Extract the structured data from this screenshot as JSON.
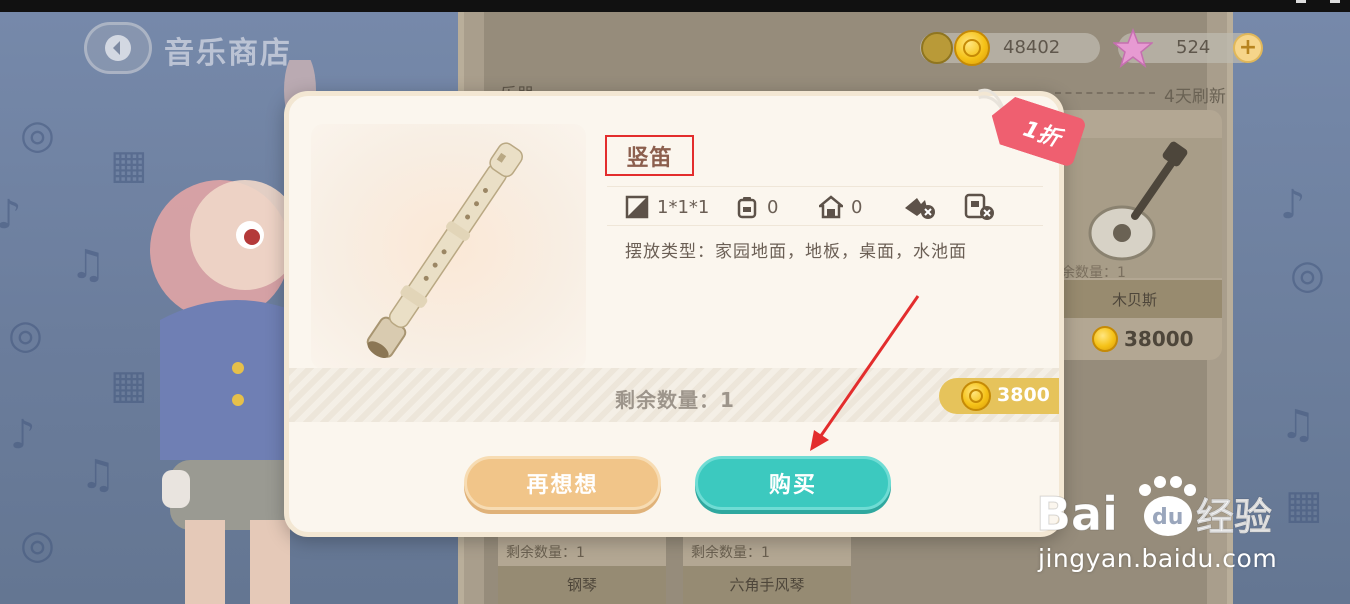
{
  "window": {
    "title": ""
  },
  "header": {
    "title": "音乐商店",
    "back_icon": "chevron-left-icon"
  },
  "currency": {
    "coins": "48402",
    "stars": "524",
    "plus_label": "+"
  },
  "shop": {
    "category_label": "乐器",
    "refresh_label": "4天刷新",
    "items": [
      {
        "name": "木贝斯",
        "price": "38000",
        "remain": "剩余数量：1"
      },
      {
        "name": "钢琴",
        "remain": "剩余数量：1"
      },
      {
        "name": "六角手风琴",
        "remain": "剩余数量：1"
      }
    ]
  },
  "modal": {
    "item_name": "竖笛",
    "discount": "1折",
    "stats": {
      "size": "1*1*1",
      "storage": "0",
      "house": "0"
    },
    "placement": "摆放类型：家园地面，地板，桌面，水池面",
    "remain": "剩余数量：1",
    "price": "3800",
    "think_button": "再想想",
    "buy_button": "购买"
  },
  "watermark": {
    "brand": "Baidu经验",
    "url": "jingyan.baidu.com"
  },
  "colors": {
    "accent": "#3cc9bf",
    "secondary_button": "#f1c589",
    "discount_tag": "#ef5f70",
    "coin": "#f5c218",
    "highlight_box": "#e32d2d",
    "annotation_arrow": "#e32d2d"
  }
}
